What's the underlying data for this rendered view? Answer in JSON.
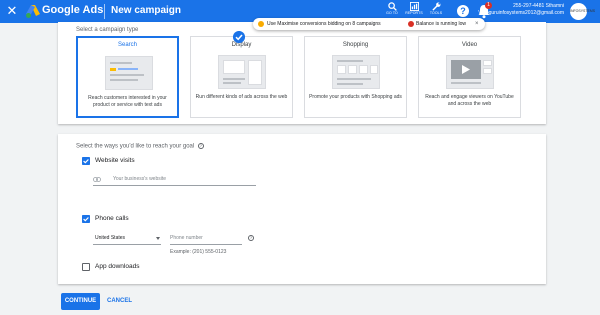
{
  "topbar": {
    "brand": "Google Ads",
    "page_title": "New campaign",
    "tools": [
      {
        "label": "GO TO",
        "icon": "search-icon"
      },
      {
        "label": "REPORTS",
        "icon": "reports-icon"
      },
      {
        "label": "TOOLS",
        "icon": "wrench-icon"
      }
    ],
    "help_glyph": "?",
    "notification_count": "1",
    "account_id": "255-297-4481 Sthamni",
    "account_email": "Webguruinfosystems2012@gmail.com",
    "avatar_text": "INFOSYSTEMS"
  },
  "notifications": {
    "n1": "Use Maximise conversions bidding on 8 campaigns",
    "n2": "Balance is running low",
    "close_glyph": "×"
  },
  "campaign_type": {
    "label": "Select a campaign type",
    "tiles": [
      {
        "title": "Search",
        "desc": "Reach customers interested in your product or service with text ads",
        "selected": true
      },
      {
        "title": "Display",
        "desc": "Run different kinds of ads across the web",
        "selected": false
      },
      {
        "title": "Shopping",
        "desc": "Promote your products with Shopping ads",
        "selected": false
      },
      {
        "title": "Video",
        "desc": "Reach and engage viewers on YouTube and across the web",
        "selected": false
      }
    ]
  },
  "goal": {
    "question": "Select the ways you'd like to reach your goal",
    "help_glyph": "?",
    "website_visits": {
      "label": "Website visits",
      "checked": true,
      "placeholder": "Your business's website"
    },
    "phone_calls": {
      "label": "Phone calls",
      "checked": true,
      "country": "United States",
      "placeholder": "Phone number",
      "example": "Example: (201) 555-0123"
    },
    "app_downloads": {
      "label": "App downloads",
      "checked": false
    }
  },
  "actions": {
    "continue": "CONTINUE",
    "cancel": "CANCEL"
  },
  "colors": {
    "primary": "#1a73e8",
    "warning": "#f9ab00",
    "error": "#d93025"
  }
}
